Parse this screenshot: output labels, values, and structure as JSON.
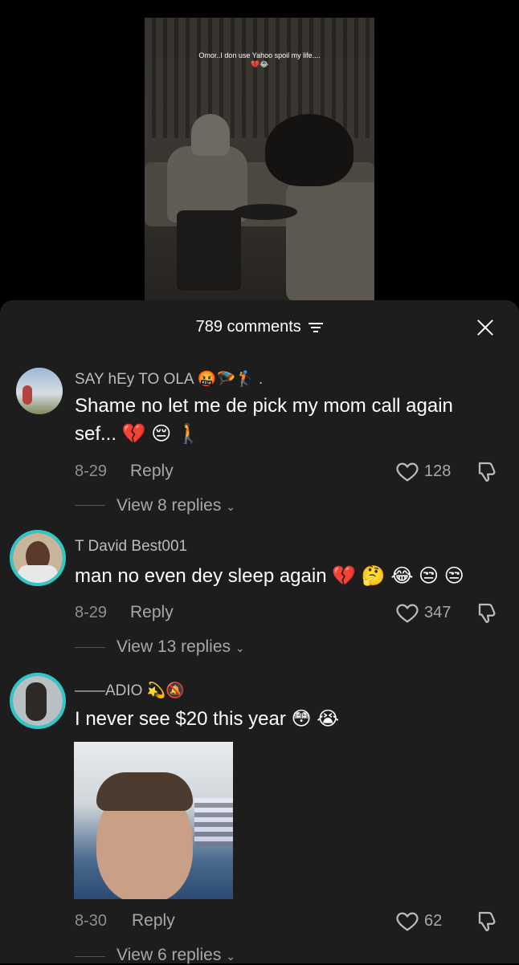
{
  "video": {
    "caption": "Omor..I don use Yahoo spoil my life....💔😂"
  },
  "header": {
    "comment_count": "789 comments"
  },
  "comments": [
    {
      "username": "SAY hEy TO OLA 🤬🪂🏌️ .",
      "text": "Shame no let me de pick my mom call again sef... 💔 😔 🚶",
      "date": "8-29",
      "reply_label": "Reply",
      "likes": "128",
      "view_replies": "View 8 replies"
    },
    {
      "username": "T David Best001",
      "text": "man no even dey sleep again 💔 🤔 😂 😒 😒",
      "date": "8-29",
      "reply_label": "Reply",
      "likes": "347",
      "view_replies": "View 13 replies"
    },
    {
      "username": "——ADIO 💫🔕",
      "text": "I never see $20 this year 😳 😭",
      "date": "8-30",
      "reply_label": "Reply",
      "likes": "62",
      "view_replies": "View 6 replies"
    }
  ],
  "colors": {
    "sheet_bg": "#1d1d1d",
    "avatar_ring": "#2fc7c7",
    "muted_text": "#8f8f8f"
  }
}
